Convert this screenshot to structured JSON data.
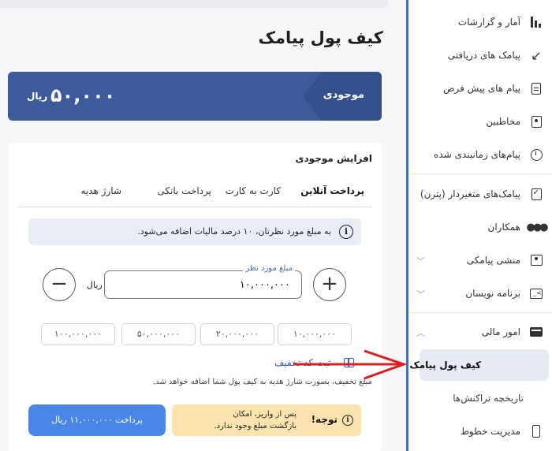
{
  "page": {
    "title": "کیف پول پیامک"
  },
  "balance": {
    "label": "موجودی",
    "amount": "۵۰,۰۰۰",
    "currency": "ریال"
  },
  "topup": {
    "title": "افزایش موجودی",
    "tabs": [
      {
        "label": "پرداخت آنلاین",
        "active": true
      },
      {
        "label": "کارت به کارت",
        "active": false
      },
      {
        "label": "پرداخت بانکی",
        "active": false
      },
      {
        "label": "شارژ هدیه",
        "active": false
      }
    ],
    "tax_note": "به مبلغ مورد نظرتان، ۱۰ درصد مالیات اضافه می‌شود.",
    "amount_field": {
      "legend": "مبلغ مورد نظر",
      "value": "۱۰,۰۰۰,۰۰۰",
      "currency": "ریال"
    },
    "minus_symbol": "−",
    "plus_symbol": "+",
    "presets": [
      "۱۰,۰۰۰,۰۰۰",
      "۲۰,۰۰۰,۰۰۰",
      "۵۰,۰۰۰,۰۰۰",
      "۱۰۰,۰۰۰,۰۰۰"
    ],
    "discount_link": "ثبت کد تخفیف",
    "discount_note": "مبلغ تخفیف، بصورت شارژ هدیه به کیف پول شما اضافه خواهد شد.",
    "pay_button": "پرداخت ۱۱,۰۰۰,۰۰۰ ریال",
    "warning": {
      "title": "توجه!",
      "message": "پس از واریز، امکان بازگشت مبلغ وجود ندارد."
    }
  },
  "sidebar": {
    "items": [
      {
        "label": "آمار و گزارشات",
        "icon": "bar-chart-icon"
      },
      {
        "label": "پیامک های دریافتی",
        "icon": "inbox-arrow-icon"
      },
      {
        "label": "پیام های پیش فرض",
        "icon": "document-icon"
      },
      {
        "label": "مخاطبین",
        "icon": "contact-book-icon"
      },
      {
        "label": "پیام‌های زمانبندی شده",
        "icon": "stopwatch-icon"
      },
      {
        "label": "پیامک‌های متغیردار (پترن)",
        "icon": "clipboard-check-icon"
      },
      {
        "label": "همکاران",
        "icon": "people-icon"
      },
      {
        "label": "منشی پیامکی",
        "icon": "id-badge-icon"
      },
      {
        "label": "برنامه نویسان",
        "icon": "terminal-icon"
      },
      {
        "label": "امور مالی",
        "icon": "wallet-icon"
      },
      {
        "label": "کیف پول پیامک",
        "active": true
      },
      {
        "label": "تاریخچه تراکنش‌ها"
      },
      {
        "label": "مدیریت خطوط",
        "icon": "phone-icon"
      }
    ]
  },
  "colors": {
    "accent": "#3b6fd4",
    "balance_card": "#3d5a9a",
    "pay_button": "#4a86e8",
    "warning_bg": "#fbe3b0",
    "annotation_arrow": "#e11b1b"
  }
}
